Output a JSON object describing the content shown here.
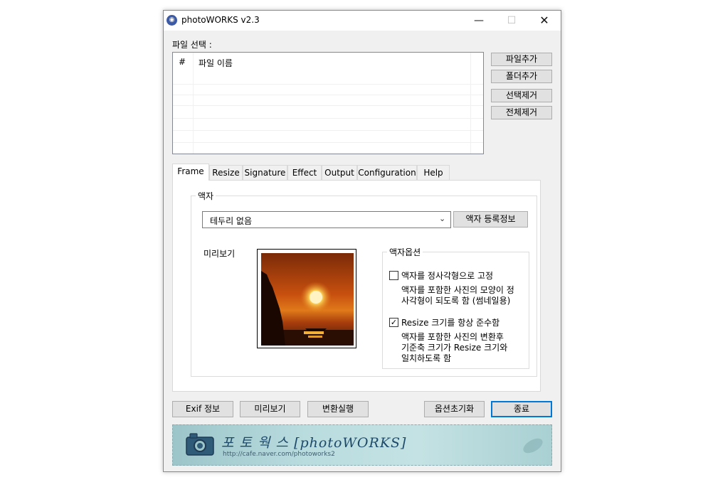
{
  "window": {
    "title": "photoWORKS v2.3",
    "icon": "camera-icon"
  },
  "file_section": {
    "label": "파일 선택 :",
    "columns": [
      "#",
      "파일 이름"
    ],
    "buttons": {
      "add_file": "파일추가",
      "add_folder": "폴더추가",
      "remove_selected": "선택제거",
      "remove_all": "전체제거"
    }
  },
  "tabs": [
    "Frame",
    "Resize",
    "Signature",
    "Effect",
    "Output",
    "Configuration",
    "Help"
  ],
  "active_tab": "Frame",
  "frame": {
    "group_label": "액자",
    "frame_select_value": "테두리 없음",
    "register_button": "액자 등록정보",
    "preview_label": "미리보기",
    "options": {
      "group_label": "액자옵션",
      "square_label": "액자를 정사각형으로 고정",
      "square_checked": false,
      "square_desc": "액자를 포함한 사진의 모양이 정\n사각형이 되도록 함 (썸네일용)",
      "resize_label": "Resize 크기를 항상 준수함",
      "resize_checked": true,
      "resize_desc": "액자를 포함한 사진의 변환후\n기준축 크기가 Resize 크기와\n일치하도록 함"
    }
  },
  "bottom_buttons": {
    "exif": "Exif 정보",
    "preview": "미리보기",
    "convert": "변환실행",
    "reset": "옵션초기화",
    "exit": "종료"
  },
  "banner": {
    "title": "포 토 웍 스 [photoWORKS]",
    "url": "http://cafe.naver.com/photoworks2"
  }
}
